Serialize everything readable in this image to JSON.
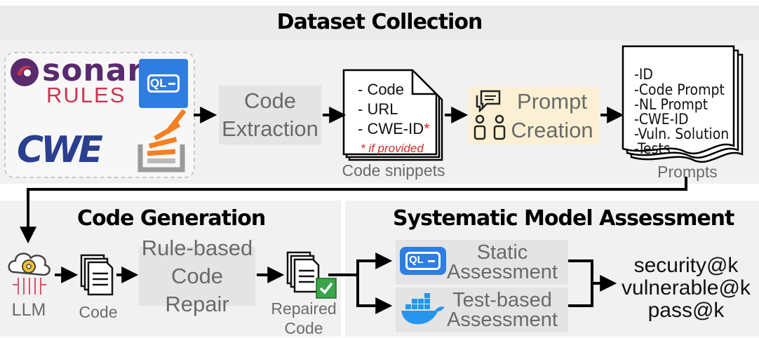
{
  "sections": {
    "dataset_collection": "Dataset Collection",
    "code_generation": "Code Generation",
    "systematic_assessment": "Systematic Model Assessment"
  },
  "sources": {
    "sonar_top": "sonar",
    "sonar_bottom": "RULES",
    "codeql_badge": "QL",
    "cwe_logo": "CWE",
    "icons": [
      "sonar-logo-icon",
      "codeql-icon",
      "cwe-logo-icon",
      "stackoverflow-icon"
    ]
  },
  "steps": {
    "code_extraction": [
      "Code",
      "Extraction"
    ],
    "prompt_creation": [
      "Prompt",
      "Creation"
    ],
    "rule_repair": [
      "Rule-based",
      "Code Repair"
    ],
    "static_assessment": [
      "Static",
      "Assessment"
    ],
    "test_assessment": [
      "Test-based",
      "Assessment"
    ]
  },
  "snippet_doc": {
    "lines": [
      "- Code",
      "- URL",
      "- CWE-ID"
    ],
    "asterisk": "*",
    "note": "* if provided",
    "caption": "Code snippets"
  },
  "prompts_doc": {
    "lines": [
      "-ID",
      "-Code Prompt",
      "-NL Prompt",
      "-CWE-ID",
      "-Vuln. Solution",
      "-Tests"
    ],
    "caption": "Prompts"
  },
  "generation": {
    "llm_label": "LLM",
    "code_label": "Code",
    "repaired_label": [
      "Repaired",
      "Code"
    ]
  },
  "metrics": [
    "security@k",
    "vulnerable@k",
    "pass@k"
  ],
  "colors": {
    "sonar_purple": "#5a2a6e",
    "sonar_red": "#c8364e",
    "codeql_blue": "#2f7de1",
    "cwe_blue": "#2b3f8f",
    "stackoverflow_orange": "#f48024",
    "docker_blue": "#2496ed",
    "check_green": "#3aa54a",
    "asterisk_red": "#d62b2b"
  }
}
